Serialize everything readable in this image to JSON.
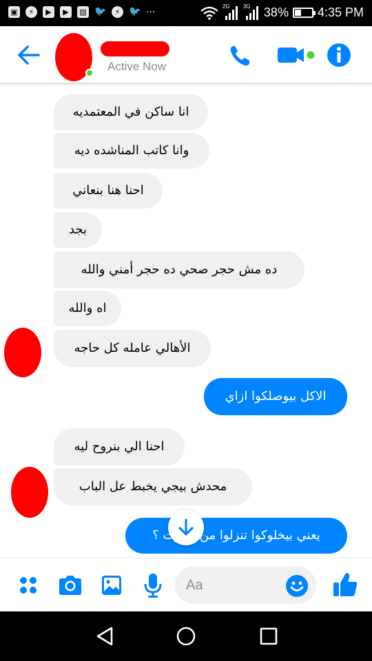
{
  "status_bar": {
    "left_icons": [
      "image-icon",
      "messenger-icon",
      "youtube-icon",
      "youtube-icon",
      "gallery-icon",
      "twitter-icon",
      "messenger-icon",
      "twitter-icon"
    ],
    "more": "···",
    "net_2g": "2G",
    "net_3g": "3G",
    "battery": "38%",
    "battery_level": 0.38,
    "time": "4:35 PM"
  },
  "header": {
    "contact_status": "Active Now"
  },
  "messages": [
    {
      "text": "انا ساكن في المعتمديه",
      "direction": "incoming"
    },
    {
      "text": "وانا كاتب المناشده ديه",
      "direction": "incoming"
    },
    {
      "text": "احنا هنا بنعاني",
      "direction": "incoming"
    },
    {
      "text": "بجد",
      "direction": "incoming"
    },
    {
      "text": "ده مش حجر صحي ده حجر أمني والله",
      "direction": "incoming"
    },
    {
      "text": "اه والله",
      "direction": "incoming"
    },
    {
      "text": "الأهالي عامله كل حاجه",
      "direction": "incoming"
    },
    {
      "text": "الاكل بيوصلكوا ازاي",
      "direction": "outgoing"
    },
    {
      "text": "احنا الي بنروح ليه",
      "direction": "incoming"
    },
    {
      "text": "محدش بيجي يخبط عل الباب",
      "direction": "incoming"
    },
    {
      "text": "يعني بيخلوكوا تنزلوا من البيوت ؟",
      "direction": "outgoing"
    }
  ],
  "composer": {
    "placeholder": "Aa"
  },
  "colors": {
    "accent": "#0084ff",
    "incoming_bubble": "#f1f0f0",
    "online": "#4cd137",
    "redaction": "#ff0000"
  }
}
